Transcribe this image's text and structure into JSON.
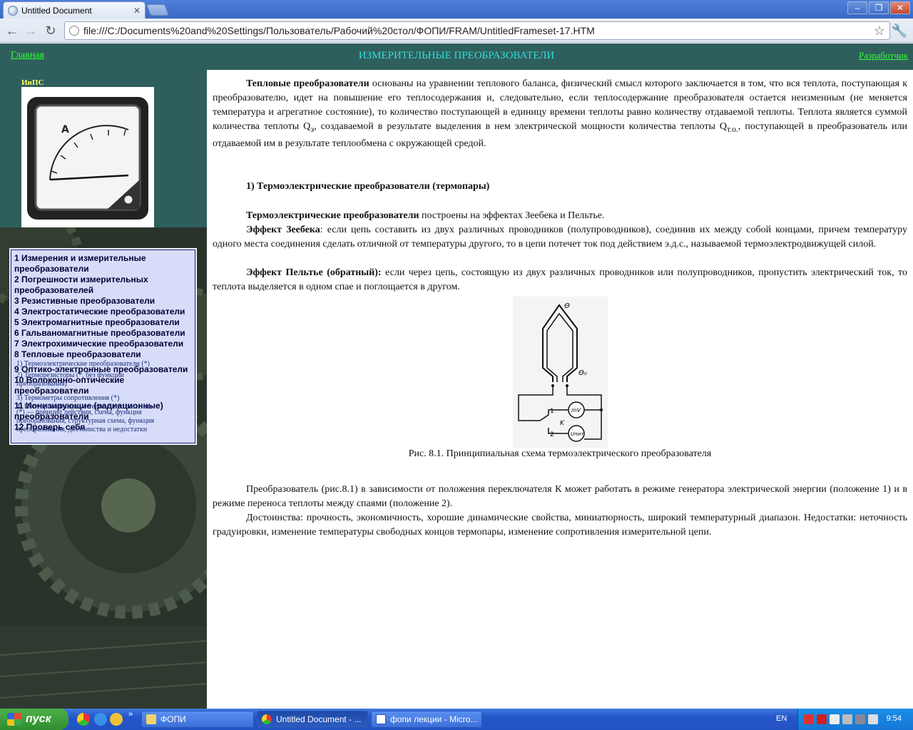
{
  "browser": {
    "tab_title": "Untitled Document",
    "url": "file:///C:/Documents%20and%20Settings/Пользователь/Рабочий%20стол/ФОПИ/FRAM/UntitledFrameset-17.HTM"
  },
  "top": {
    "home_link": "Главная",
    "title": "ИЗМЕРИТЕЛЬНЫЕ ПРЕОБРАЗОВАТЕЛИ",
    "developer_link": "Разработчик"
  },
  "sidebar": {
    "logo_label": "ИиПС",
    "menu": [
      "1 Измерения и измерительные преобразователи",
      "2 Погрешности измерительных преобразователей",
      "3 Резистивные преобразователи",
      "4 Электростатические преобразователи",
      "5 Электромагнитные преобразователи",
      "6 Гальваномагнитные преобразователи",
      "7 Электрохимические преобразователи",
      "8 Тепловые преобразователи",
      "9 Оптико-электронные преобразователи",
      "10 Волоконно-оптические преобразователи",
      "11 Ионизирующие (радиационные) преобразователи",
      "12 Проверь себя"
    ],
    "submenu": [
      "1) Термоэлектрические преобразователи (*)",
      "2) Терморезисторы (*, без функции преобразования)",
      "3) Термометры сопротивления (*)",
      "4) Полупроводниковые термосопротивления",
      "(*) — принцип действия, схема, функция преобразования, структурная схема, функция преобразования, достоинства и недостатки"
    ]
  },
  "content": {
    "p1_bold": "Тепловые преобразователи",
    "p1_a": " основаны на уравнении теплового баланса, физический смысл которого заключается в том, что вся теплота, поступающая к преобразователю, идет на повышение его теплосодержания и, следовательно, если теплосодержание преобразователя остается неизменным (не меняется температура и агрегатное состояние), то количество поступающей в единицу времени теплоты равно количеству отдаваемой теплоты. Теплота является суммой количества теплоты Q",
    "p1_sub1": "э",
    "p1_b": ", создаваемой в результате выделения в нем электрической мощности количества теплоты Q",
    "p1_sub2": "т.о.",
    "p1_c": ", поступающей в преобразователь или отдаваемой им в результате теплообмена с окружающей средой.",
    "heading1": "1) Термоэлектрические преобразователи (термопары)",
    "p2_bold": "Термоэлектрические преобразователи",
    "p2_text": "  построены на эффектах Зеебека и Пельтье.",
    "p3_bold": "Эффект Зеебека",
    "p3_text": ": если цепь составить из двух различных проводников (полупроводников), соединив их между собой концами, причем температуру одного места соединения сделать отличной от температуры другого, то в цепи потечет ток под действием э.д.с., называемой термоэлектродвижущей силой.",
    "p4_bold": "Эффект Пельтье (обратный):",
    "p4_text": " если через цепь, состоящую из двух различных проводников или полупроводников, пропустить электрический ток, то теплота выделяется в одном спае и поглощается в другом.",
    "figure_labels": {
      "theta": "Θ",
      "theta0": "Θ₀",
      "mv": "mV",
      "unit": "Uпит",
      "k": "K",
      "pos1": "1",
      "pos2": "2"
    },
    "caption": "Рис. 8.1. Принципиальная схема термоэлектрического преобразователя",
    "p5": "Преобразователь (рис.8.1) в зависимости от положения переключателя К может работать в режиме генератора электрической энергии (положение 1) и в режиме переноса теплоты между спаями (положение 2).",
    "p6": "Достоинства: прочность, экономичность, хорошие динамические свойства, миниатюрность, широкий температурный диапазон. Недостатки: неточность градуировки, изменение температуры свободных концов термопары, изменение сопротивления измерительной цепи."
  },
  "taskbar": {
    "start": "пуск",
    "tasks": [
      "ФОПИ",
      "Untitled Document - ...",
      "фопи лекции - Micro..."
    ],
    "lang": "EN",
    "clock": "9:54"
  },
  "colors": {
    "page_bg": "#2f5f5c",
    "link_green": "#33ff33",
    "title_cyan": "#33dddd",
    "menu_bg": "#d7ddf9"
  }
}
